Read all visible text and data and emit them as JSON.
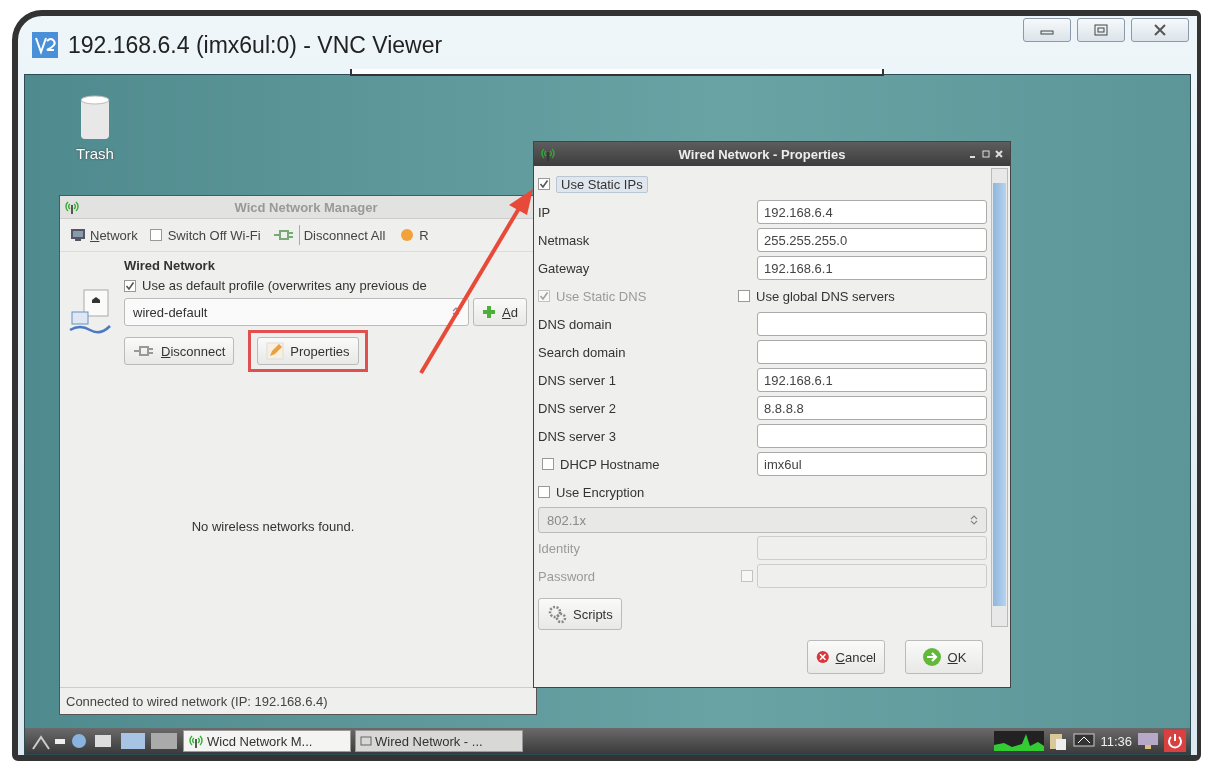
{
  "window": {
    "title": "192.168.6.4 (imx6ul:0) - VNC Viewer"
  },
  "desktop_icons": [
    {
      "label": "Trash"
    }
  ],
  "wicd_manager": {
    "title": "Wicd Network Manager",
    "toolbar": [
      {
        "kind": "button",
        "label": "Network"
      },
      {
        "kind": "checkbox",
        "label": "Switch Off Wi-Fi",
        "checked": false
      },
      {
        "kind": "button",
        "label": "Disconnect All"
      },
      {
        "kind": "button",
        "label": "R"
      }
    ],
    "wired": {
      "heading": "Wired Network",
      "default_profile": {
        "label": "Use as default profile (overwrites any previous de",
        "checked": true
      },
      "profile": "wired-default",
      "add_button": "Ad",
      "buttons": [
        "Disconnect",
        "Properties"
      ]
    },
    "message": "No wireless networks found.",
    "status_bar": "Connected to wired network (IP: 192.168.6.4)"
  },
  "properties": {
    "title": "Wired Network - Properties",
    "rows": [
      {
        "kind": "checkbox",
        "label": "Use Static IPs",
        "checked": true,
        "disabled": false
      },
      {
        "kind": "field",
        "label": "IP",
        "value": "192.168.6.4",
        "disabled": false
      },
      {
        "kind": "field",
        "label": "Netmask",
        "value": "255.255.255.0",
        "disabled": false
      },
      {
        "kind": "field",
        "label": "Gateway",
        "value": "192.168.6.1",
        "disabled": false
      },
      {
        "kind": "check_pair",
        "label": "Use Static DNS",
        "checked": true,
        "disabled": true,
        "second": {
          "label": "Use global DNS servers",
          "checked": false
        }
      },
      {
        "kind": "field",
        "label": "DNS domain",
        "disabled": false
      },
      {
        "kind": "field",
        "label": "Search domain",
        "disabled": false
      },
      {
        "kind": "field",
        "label": "DNS server 1",
        "value": "192.168.6.1",
        "disabled": false
      },
      {
        "kind": "field",
        "label": "DNS server 2",
        "value": "8.8.8.8",
        "disabled": false
      },
      {
        "kind": "field",
        "label": "DNS server 3",
        "disabled": false
      },
      {
        "kind": "check_field",
        "label": "DHCP Hostname",
        "checked": false,
        "value": "imx6ul"
      },
      {
        "kind": "checkbox",
        "label": "Use Encryption",
        "checked": false,
        "disabled": false
      },
      {
        "kind": "select",
        "value": "802.1x",
        "disabled": true
      },
      {
        "kind": "field",
        "label": "Identity",
        "disabled": true
      },
      {
        "kind": "password",
        "label": "Password",
        "disabled": true,
        "checked": false
      }
    ],
    "scripts_button": "Scripts",
    "buttons": [
      {
        "kind": "cancel",
        "label": "Cancel"
      },
      {
        "kind": "ok",
        "label": "OK"
      }
    ]
  },
  "taskbar": {
    "tasks": [
      {
        "label": "Wicd Network M...",
        "selected": true
      },
      {
        "label": "Wired Network - ...",
        "selected": false
      }
    ],
    "clock": "11:36"
  }
}
